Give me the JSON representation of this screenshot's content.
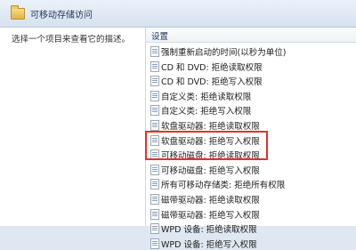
{
  "header": {
    "title": "可移动存储访问"
  },
  "left_pane": {
    "description": "选择一个项目来查看它的描述。"
  },
  "right_pane": {
    "column_header": "设置",
    "items": [
      {
        "label": "强制重新启动的时间(以秒为单位)",
        "icon": "policy-setting-icon"
      },
      {
        "label": "CD 和 DVD: 拒绝读取权限",
        "icon": "policy-setting-icon"
      },
      {
        "label": "CD 和 DVD: 拒绝写入权限",
        "icon": "policy-setting-icon"
      },
      {
        "label": "自定义类: 拒绝读取权限",
        "icon": "policy-setting-icon"
      },
      {
        "label": "自定义类: 拒绝写入权限",
        "icon": "policy-setting-icon"
      },
      {
        "label": "软盘驱动器: 拒绝读取权限",
        "icon": "policy-setting-icon"
      },
      {
        "label": "软盘驱动器: 拒绝写入权限",
        "icon": "policy-setting-icon"
      },
      {
        "label": "可移动磁盘: 拒绝读取权限",
        "icon": "policy-setting-icon"
      },
      {
        "label": "可移动磁盘: 拒绝写入权限",
        "icon": "policy-setting-icon"
      },
      {
        "label": "所有可移动存储类: 拒绝所有权限",
        "icon": "policy-setting-icon"
      },
      {
        "label": "磁带驱动器: 拒绝读取权限",
        "icon": "policy-setting-icon"
      },
      {
        "label": "磁带驱动器: 拒绝写入权限",
        "icon": "policy-setting-icon"
      },
      {
        "label": "WPD 设备: 拒绝读取权限",
        "icon": "policy-setting-icon"
      },
      {
        "label": "WPD 设备: 拒绝写入权限",
        "icon": "policy-setting-icon"
      }
    ]
  },
  "colors": {
    "highlight": "#e2322c"
  }
}
